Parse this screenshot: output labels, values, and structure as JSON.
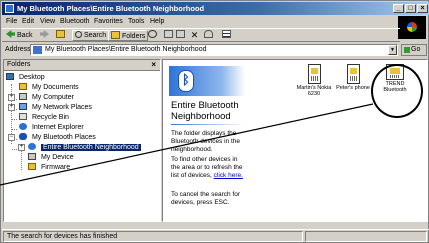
{
  "window": {
    "title": "My Bluetooth Places\\Entire Bluetooth Neighborhood",
    "controls": {
      "minimize": "_",
      "maximize": "□",
      "close": "×"
    }
  },
  "menu": [
    "File",
    "Edit",
    "View",
    "Bluetooth",
    "Favorites",
    "Tools",
    "Help"
  ],
  "toolbar": {
    "back": "Back",
    "search": "Search",
    "folders": "Folders"
  },
  "address": {
    "label": "Address",
    "value": "My Bluetooth Places\\Entire Bluetooth Neighborhood",
    "go": "Go"
  },
  "folders_pane": {
    "title": "Folders",
    "close": "×",
    "tree": [
      {
        "label": "Desktop"
      },
      {
        "label": "My Documents"
      },
      {
        "label": "My Computer"
      },
      {
        "label": "My Network Places"
      },
      {
        "label": "Recycle Bin"
      },
      {
        "label": "Internet Explorer"
      },
      {
        "label": "My Bluetooth Places"
      },
      {
        "label": "Entire Bluetooth Neighborhood"
      },
      {
        "label": "My Device"
      },
      {
        "label": "Firmware"
      }
    ]
  },
  "info": {
    "title": "Entire Bluetooth Neighborhood",
    "p1": "The folder displays the Bluetooth devices in the neighborhood.",
    "p2": "To find other devices in the area or to refresh the list of devices,",
    "link": "click here.",
    "p3": "To cancel the search for devices, press ESC."
  },
  "devices": [
    {
      "label": "Martin's Nokia 6230"
    },
    {
      "label": "Peter's phone"
    },
    {
      "label": "TREND Bluetooth"
    }
  ],
  "status": {
    "text": "The search for devices has finished"
  }
}
